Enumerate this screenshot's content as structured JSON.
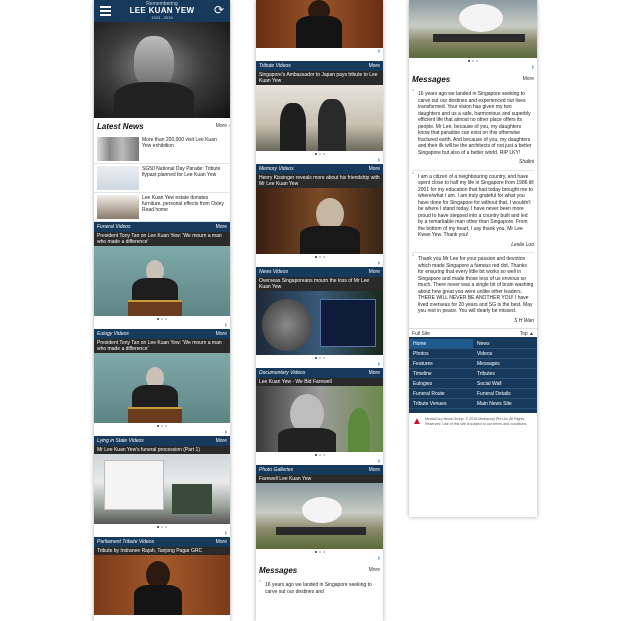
{
  "header": {
    "menu_icon": "hamburger-menu-icon",
    "remembering": "Remembering",
    "title": "LEE KUAN YEW",
    "years": "1923 - 2015",
    "refresh_icon": "refresh-icon"
  },
  "more_label": "More",
  "chevron": "›",
  "latest_news": {
    "title": "Latest News",
    "items": [
      {
        "text": "More than 200,000 visit Lee Kuan Yew exhibition"
      },
      {
        "text": "SG50 National Day Parade: Tribute flypast planned for Lee Kuan Yew"
      },
      {
        "text": "Lee Kuan Yew estate donates furniture, personal effects from Oxley Road home"
      }
    ]
  },
  "col1_blocks": [
    {
      "section": "Funeral Videos",
      "caption": "President Tony Tan on Lee Kuan Yew: 'We mourn a man who made a difference'"
    },
    {
      "section": "Eulogy Videos",
      "caption": "President Tony Tan on Lee Kuan Yew: 'We mourn a man who made a difference'"
    },
    {
      "section": "Lying in State Videos",
      "caption": "Mr Lee Kuan Yew's funeral procession (Part 1)"
    },
    {
      "section": "Parliament Tribute Videos",
      "caption": "Tribute by Indranee Rajah, Tanjong Pagar GRC"
    }
  ],
  "col2_blocks": [
    {
      "section": "Tribute Videos",
      "caption": "Singapore's Ambassador to Japan pays tribute to Lee Kuan Yew"
    },
    {
      "section": "Memory Videos",
      "caption": "Henry Kissinger reveals more about his friendship with Mr Lee Kuan Yew"
    },
    {
      "section": "News Videos",
      "caption": "Overseas Singaporeans mourn the loss of Mr Lee Kuan Yew"
    },
    {
      "section": "Documentary Videos",
      "caption": "Lee Kuan Yew - We Bid Farewell"
    },
    {
      "section": "Photo Galleries",
      "caption": "Farewell Lee Kuan Yew"
    }
  ],
  "messages": {
    "title": "Messages",
    "items": [
      {
        "text": "16 years ago we landed in Singapore seeking to carve out our destines and experienced our lives transformed. Your vision has given my two daughters and us a safe, harmonious and superbly efficient life that almost no other place offers its people. Mr Lee, because of you, my daughters know that paradise can exist on this otherwise fractured earth. And because of you, my daughters and their ilk will be the architects of not just a better Singapore but also of a better world. RIP LKY!",
        "author": "Shalini"
      },
      {
        "text": "I am a citizen of a neighbouring country, and have spent close to half my life in Singapore from 1986 till 2001 for my education that had today brought me to where/what I am. I am truly grateful for what you have done for Singapore for without that, I wouldn't be where I stand today. I have never been more proud to have stepped into a country built and led by a remarkable man other than Singapore. From the bottom of my heart, I say thank you, Mr Lee Kwan Yew. Thank you!",
        "author": "Leslie Loo"
      },
      {
        "text": "Thank you Mr Lee for your passion and devotion which made Singapore a famous red dot. Thanks for ensuring that every little bit works so well in Singapore and made those less of us envious so much. There never was a single bit of brain washing about how great you were unlike other leaders. THERE WILL NEVER BE ANOTHER YOU! I have lived overseas for 20 years and SG is the best. May you rest in peace. You will dearly be missed.",
        "author": "S H Wan"
      }
    ],
    "col2_preview": "16 years ago we landed in Singapore seeking to carve out our destines and"
  },
  "footer": {
    "full_site": "Full Site",
    "top": "Top",
    "links": [
      "Home",
      "News",
      "Photos",
      "Videos",
      "Features",
      "Messages",
      "Timeline",
      "Tributes",
      "Eulogies",
      "Social Wall",
      "Funeral Route",
      "Funeral Details",
      "Tribute Venues",
      "Main News Site"
    ],
    "copyright": "MediaCorp News Group. © 2015 Mediacorp Pte Ltd. All Rights Reserved. Use of this site is subject to our terms and conditions"
  }
}
